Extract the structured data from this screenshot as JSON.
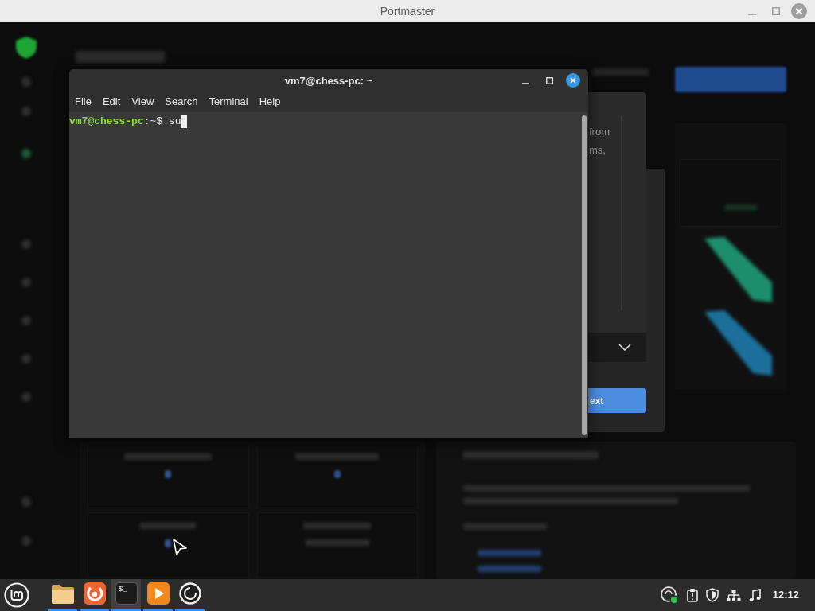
{
  "window": {
    "title": "Portmaster"
  },
  "terminal": {
    "title": "vm7@chess-pc: ~",
    "menu": [
      "File",
      "Edit",
      "View",
      "Search",
      "Terminal",
      "Help"
    ],
    "lines": [
      {
        "segments": [
          {
            "kind": "user",
            "text": "vm7@chess-pc"
          },
          {
            "kind": "plain",
            "text": ":~$ su"
          }
        ],
        "cursor": true
      }
    ]
  },
  "dialog": {
    "list_lines": [
      "from",
      "ms,"
    ],
    "button": "ext"
  },
  "taskbar": {
    "apps": [
      {
        "kind": "folder",
        "running": true,
        "selected": false
      },
      {
        "kind": "browser",
        "running": true,
        "selected": false
      },
      {
        "kind": "terminal",
        "glyph": "$_",
        "running": true,
        "selected": true
      },
      {
        "kind": "media",
        "running": true,
        "selected": false
      },
      {
        "kind": "ring",
        "running": true,
        "selected": false
      }
    ],
    "clock": "12:12"
  }
}
